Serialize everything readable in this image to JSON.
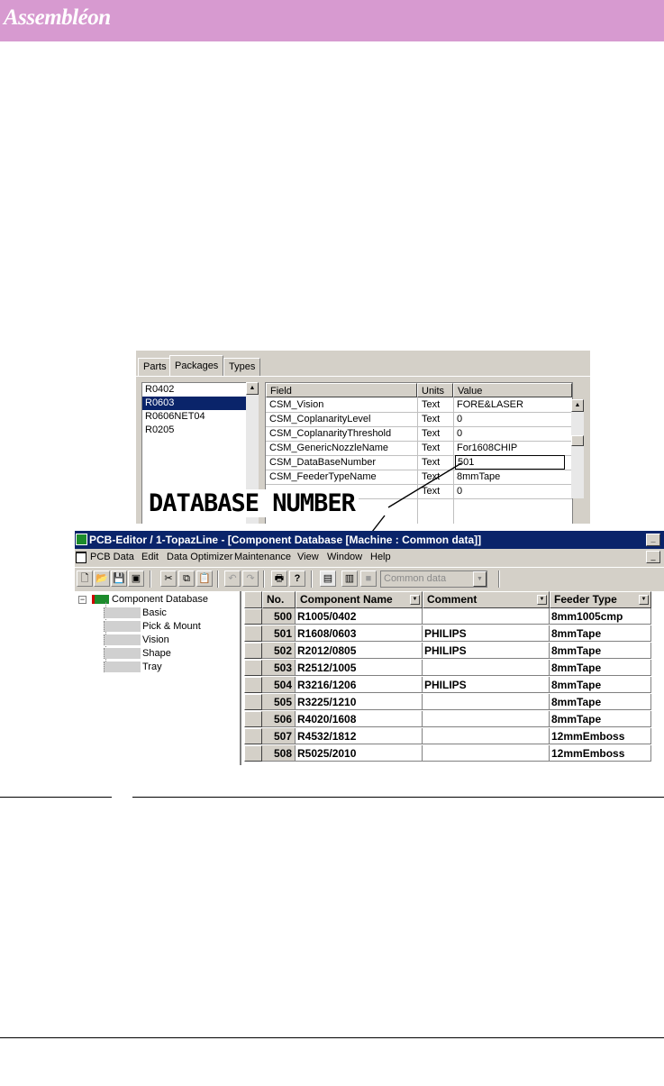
{
  "brand": {
    "logo": "Assembléon",
    "bar_color": "#d79ad0"
  },
  "properties_panel": {
    "tabs": [
      "Parts",
      "Packages",
      "Types"
    ],
    "active_tab": "Packages",
    "packages": [
      "R0402",
      "R0603",
      "R0606NET04",
      "R0205"
    ],
    "selected_package": "R0603",
    "columns": {
      "field": "Field",
      "units": "Units",
      "value": "Value"
    },
    "rows": [
      {
        "field": "CSM_Vision",
        "units": "Text",
        "value": "FORE&LASER"
      },
      {
        "field": "CSM_CoplanarityLevel",
        "units": "Text",
        "value": "0"
      },
      {
        "field": "CSM_CoplanarityThreshold",
        "units": "Text",
        "value": "0"
      },
      {
        "field": "CSM_GenericNozzleName",
        "units": "Text",
        "value": "For1608CHIP"
      },
      {
        "field": "CSM_DataBaseNumber",
        "units": "Text",
        "value": "501"
      },
      {
        "field": "CSM_FeederTypeName",
        "units": "Text",
        "value": "8mmTape"
      },
      {
        "field": "",
        "units": "Text",
        "value": "0"
      }
    ]
  },
  "annotation": {
    "label": "DATABASE NUMBER"
  },
  "editor": {
    "title": "PCB-Editor / 1-TopazLine - [Component Database [Machine : Common data]]",
    "menu": [
      "PCB Data",
      "Edit",
      "Data Optimizer",
      "Maintenance",
      "View",
      "Window",
      "Help"
    ],
    "toolbar": {
      "new_glyph": "🗋",
      "open_glyph": "📂",
      "save_glyph": "💾",
      "save_all_glyph": "▣",
      "cut_glyph": "✂",
      "copy_glyph": "⧉",
      "paste_glyph": "📋",
      "undo_glyph": "↶",
      "redo_glyph": "↷",
      "print_glyph": "🖶",
      "help_glyph": "?",
      "view1_glyph": "▤",
      "view2_glyph": "▥",
      "view3_glyph": "■",
      "combo_value": "Common data",
      "combo_arrow": "▼"
    },
    "minimize_glyph": "_",
    "tree": {
      "root": "Component Database",
      "expander": "−",
      "items": [
        "Basic",
        "Pick & Mount",
        "Vision",
        "Shape",
        "Tray"
      ]
    },
    "grid": {
      "columns": [
        "No.",
        "Component Name",
        "Comment",
        "Feeder Type"
      ],
      "dropdown_glyph": "▼",
      "rows": [
        {
          "no": "500",
          "name": "R1005/0402",
          "comment": "",
          "feeder": "8mm1005cmp"
        },
        {
          "no": "501",
          "name": "R1608/0603",
          "comment": "PHILIPS",
          "feeder": "8mmTape"
        },
        {
          "no": "502",
          "name": "R2012/0805",
          "comment": "PHILIPS",
          "feeder": "8mmTape"
        },
        {
          "no": "503",
          "name": "R2512/1005",
          "comment": "",
          "feeder": "8mmTape"
        },
        {
          "no": "504",
          "name": "R3216/1206",
          "comment": "PHILIPS",
          "feeder": "8mmTape"
        },
        {
          "no": "505",
          "name": "R3225/1210",
          "comment": "",
          "feeder": "8mmTape"
        },
        {
          "no": "506",
          "name": "R4020/1608",
          "comment": "",
          "feeder": "8mmTape"
        },
        {
          "no": "507",
          "name": "R4532/1812",
          "comment": "",
          "feeder": "12mmEmboss"
        },
        {
          "no": "508",
          "name": "R5025/2010",
          "comment": "",
          "feeder": "12mmEmboss"
        }
      ]
    }
  }
}
